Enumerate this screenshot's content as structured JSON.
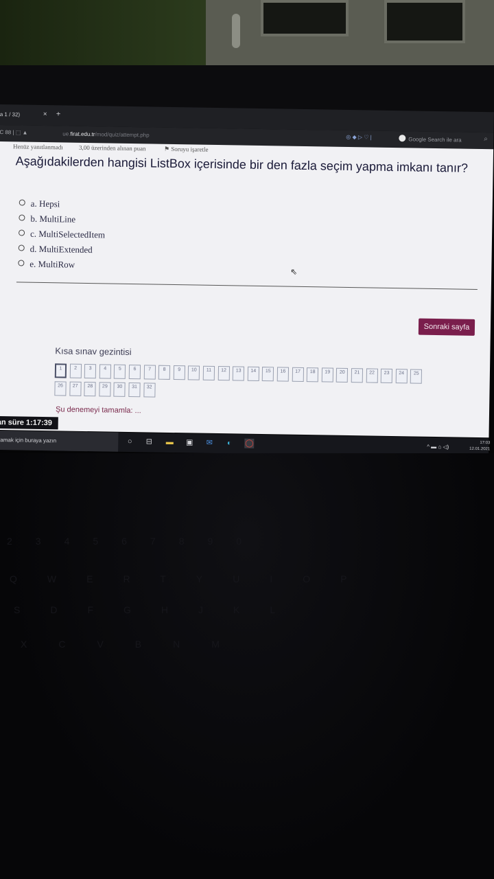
{
  "browser": {
    "tab_title": "a 1 / 32)",
    "tab_close": "×",
    "tab_new": "+",
    "nav_icons": "C  88  |  ⬚  ▲",
    "url_prefix": "ue.",
    "url_domain": "firat.edu.tr",
    "url_path": "/mod/quiz/attempt.php",
    "addon_icons": "◎ ◆ ▷ ♡ |",
    "search_placeholder": "Google Search ile ara"
  },
  "quiz": {
    "status": "Henüz yanıtlanmadı",
    "points": "3,00 üzerinden alınan puan",
    "flag": "Soruyu işaretle",
    "question": "Aşağıdakilerden hangisi ListBox içerisinde bir den fazla seçim yapma imkanı tanır?",
    "options": [
      "a. Hepsi",
      "b. MultiLine",
      "c. MultiSelectedItem",
      "d. MultiExtended",
      "e. MultiRow"
    ],
    "next_button": "Sonraki sayfa",
    "nav_title": "Kısa sınav gezintisi",
    "question_numbers": [
      "1",
      "2",
      "3",
      "4",
      "5",
      "6",
      "7",
      "8",
      "9",
      "10",
      "11",
      "12",
      "13",
      "14",
      "15",
      "16",
      "17",
      "18",
      "19",
      "20",
      "21",
      "22",
      "23",
      "24",
      "25",
      "26",
      "27",
      "28",
      "29",
      "30",
      "31",
      "32"
    ],
    "current_question": "1",
    "finish_link": "Şu denemeyi tamamla: ...",
    "timer_label": "ian süre",
    "timer_value": "1:17:39"
  },
  "taskbar": {
    "search_text": "Aramak için buraya yazın",
    "tray_icons": "^ ▬ ⌂ ◁)",
    "time": "17:03",
    "date": "12.01.2021"
  },
  "colors": {
    "accent": "#7a1e4c",
    "page_background": "#f1f1f4",
    "browser_chrome": "#1f2024"
  }
}
